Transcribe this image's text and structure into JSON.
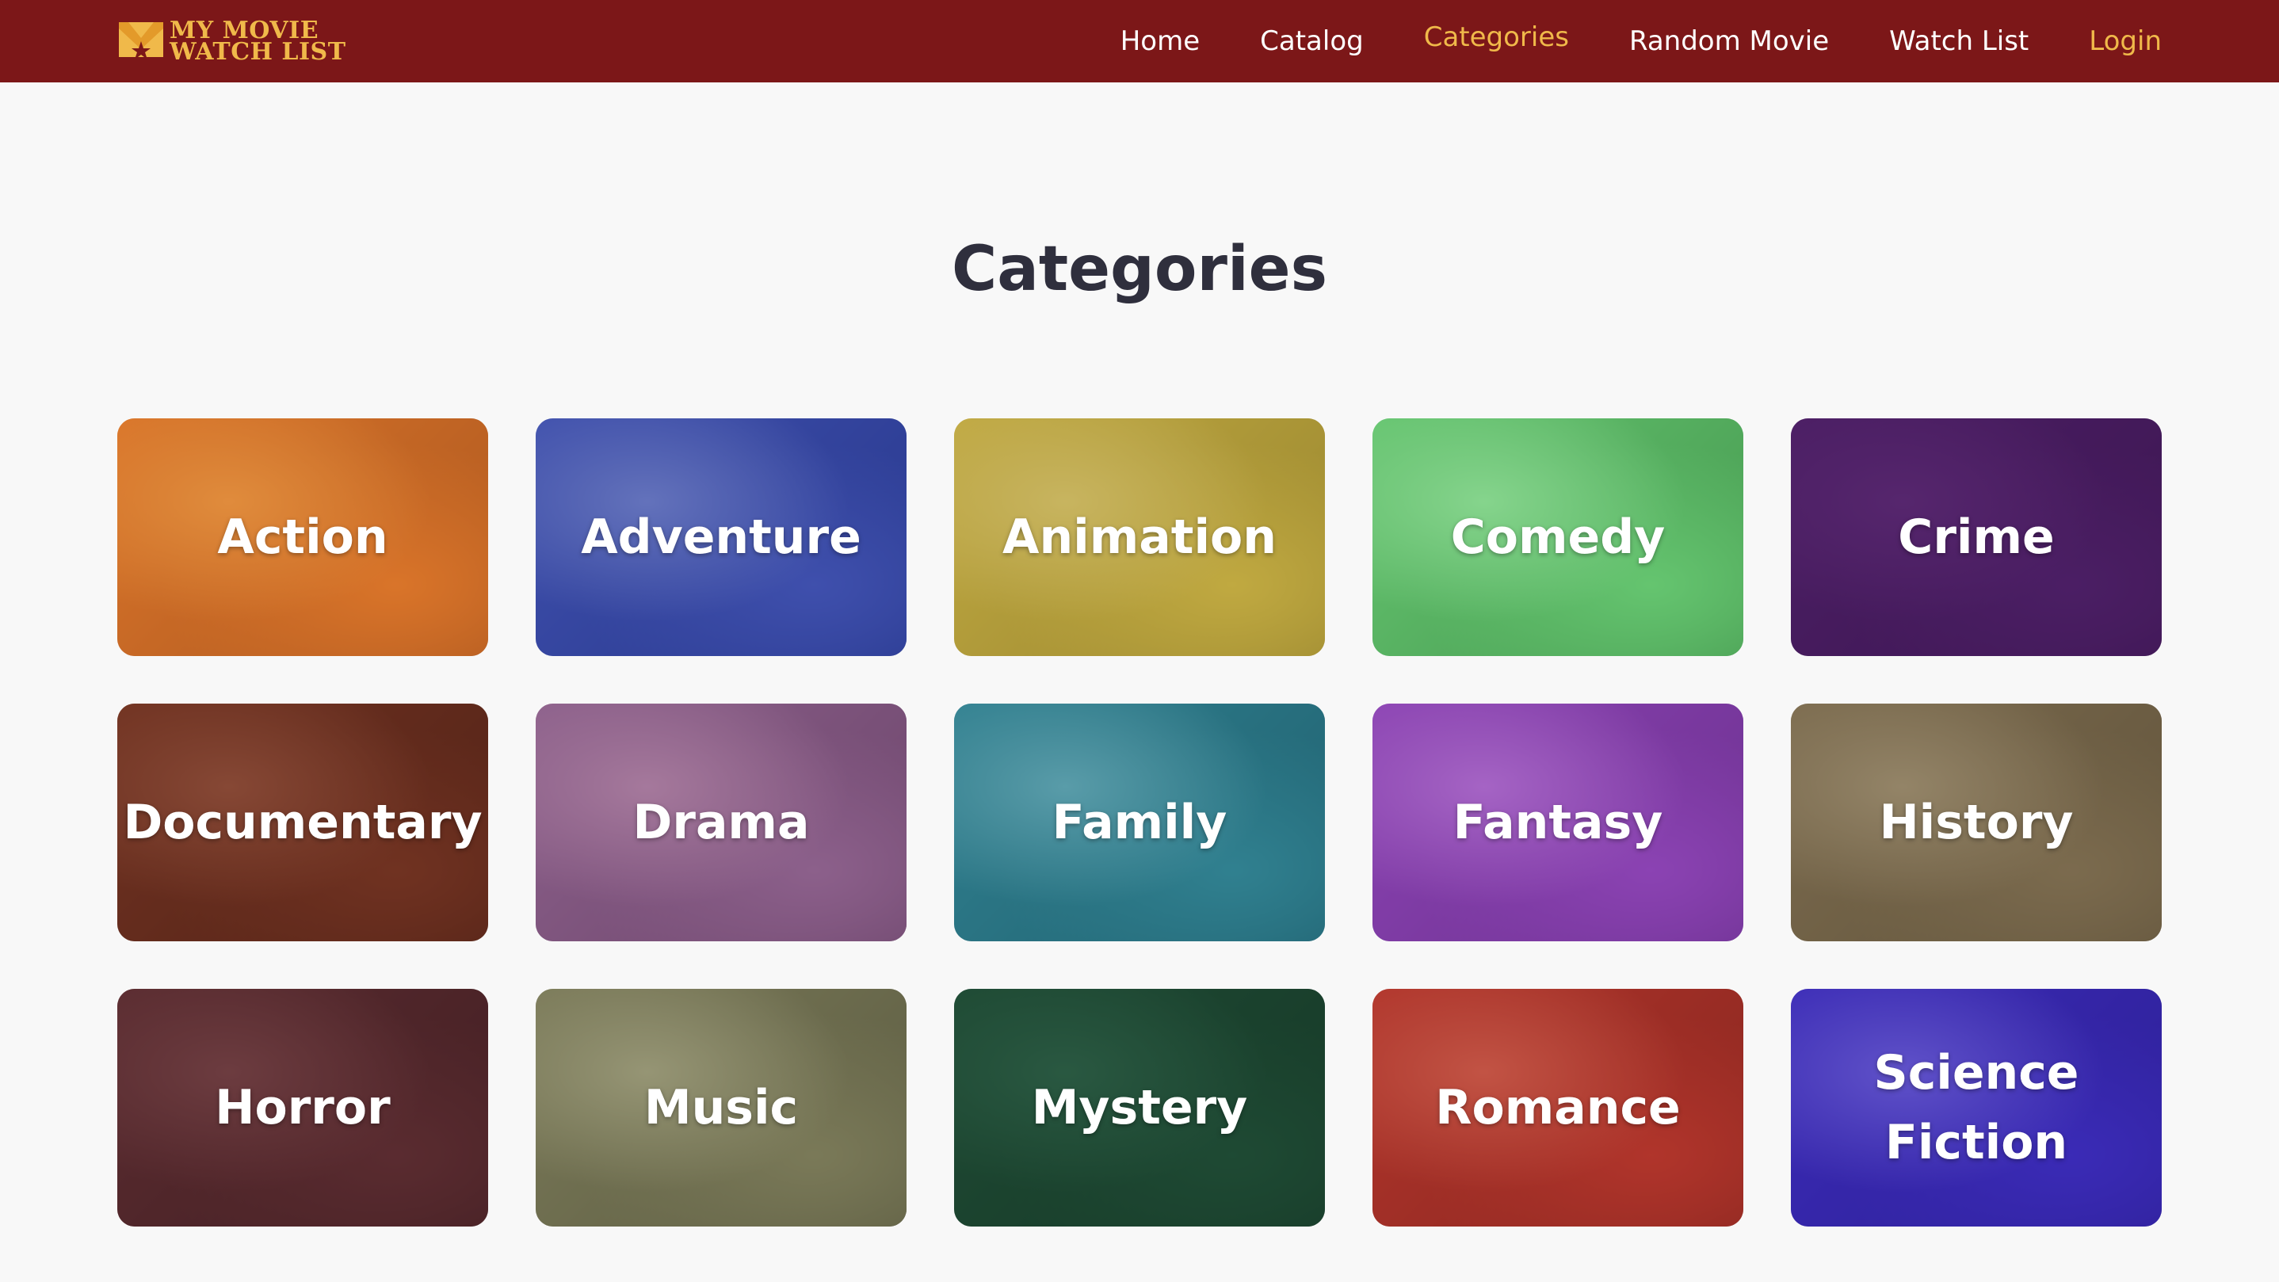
{
  "brand": {
    "line1": "MY MOVIE",
    "line2": "WATCH LIST",
    "color": "#f0b94a"
  },
  "nav": {
    "items": [
      {
        "label": "Home",
        "state": "default"
      },
      {
        "label": "Catalog",
        "state": "default"
      },
      {
        "label": "Categories",
        "state": "active"
      },
      {
        "label": "Random Movie",
        "state": "default"
      },
      {
        "label": "Watch List",
        "state": "default"
      },
      {
        "label": "Login",
        "state": "login"
      }
    ],
    "background": "#7c1718"
  },
  "page": {
    "title": "Categories"
  },
  "categories": [
    {
      "label": "Action",
      "overlay": "#d5742a",
      "scene": [
        "#6b2a10",
        "#e0752a",
        "#f2b25a"
      ]
    },
    {
      "label": "Adventure",
      "overlay": "#2f3ea0",
      "scene": [
        "#1d2f6e",
        "#5a6ec2",
        "#b9c8e8"
      ]
    },
    {
      "label": "Animation",
      "overlay": "#b6a23c",
      "scene": [
        "#6a5a1c",
        "#d0b64a",
        "#e4d39a"
      ]
    },
    {
      "label": "Comedy",
      "overlay": "#5fc86a",
      "scene": [
        "#1d4a24",
        "#6fbf78",
        "#c4e8c4"
      ]
    },
    {
      "label": "Crime",
      "overlay": "#4a1c63",
      "scene": [
        "#2a1039",
        "#4d2468",
        "#6a3880"
      ]
    },
    {
      "label": "Documentary",
      "overlay": "#6a2d1e",
      "scene": [
        "#2b120c",
        "#7a3b26",
        "#b4745a"
      ]
    },
    {
      "label": "Drama",
      "overlay": "#8a5a8a",
      "scene": [
        "#3b2438",
        "#8f6a8c",
        "#d0aab8"
      ]
    },
    {
      "label": "Family",
      "overlay": "#2a7a8a",
      "scene": [
        "#103844",
        "#3c8a98",
        "#a6d2da"
      ]
    },
    {
      "label": "Fantasy",
      "overlay": "#8a3fb0",
      "scene": [
        "#3a1a5a",
        "#8c4ab8",
        "#d0a0e6"
      ]
    },
    {
      "label": "History",
      "overlay": "#7a6a4e",
      "scene": [
        "#3a3020",
        "#7d6c50",
        "#bcae92"
      ]
    },
    {
      "label": "Horror",
      "overlay": "#5a2a2e",
      "scene": [
        "#1e0e10",
        "#5a2f33",
        "#8a5a5c"
      ]
    },
    {
      "label": "Music",
      "overlay": "#7a7a58",
      "scene": [
        "#2c2c1e",
        "#7a7858",
        "#c2c0a2"
      ]
    },
    {
      "label": "Mystery",
      "overlay": "#1e4a34",
      "scene": [
        "#0a1e14",
        "#1f4a35",
        "#3c7058"
      ]
    },
    {
      "label": "Romance",
      "overlay": "#b0322a",
      "scene": [
        "#4a1410",
        "#b23a2e",
        "#e08a70"
      ]
    },
    {
      "label": "Science\nFiction",
      "overlay": "#3a28b8",
      "scene": [
        "#1a1260",
        "#3c30b4",
        "#9e96e6"
      ]
    }
  ]
}
